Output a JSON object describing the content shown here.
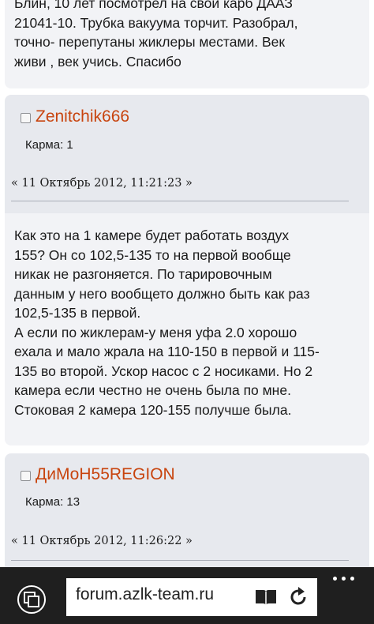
{
  "posts": [
    {
      "body_lines": [
        "Блин, 10 лет посмотрел на свой карб ДААЗ",
        "21041-10. Трубка вакуума торчит. Разобрал,",
        "точно- перепутаны жиклеры местами. Век",
        "живи , век учись. Спасибо"
      ]
    },
    {
      "author": "Zenitchik666",
      "karma": "Карма: 1",
      "date": "« 11 Октябрь 2012, 11:21:23 »",
      "body_lines": [
        "Как это на 1 камере будет работать воздух",
        "155? Он со 102,5-135 то на первой вообще",
        "никак не разгоняется. По тарировочным",
        "данным у него вообщето должно быть как раз",
        "102,5-135 в первой.",
        "А если по жиклерам-у меня уфа 2.0 хорошо",
        "ехала и мало жрала на 110-150 в первой и 115-",
        "135 во второй. Ускор насос с 2 носиками. Но 2",
        "камера если честно не очень была по мне.",
        "Стоковая 2 камера 120-155 получше была."
      ]
    },
    {
      "author": "ДиМоН55REGION",
      "karma": "Карма: 13",
      "date": "« 11 Октябрь 2012, 11:26:22 »"
    }
  ],
  "browser": {
    "address": "forum.azlk-team.ru",
    "icons": {
      "tabs": "tabs-icon",
      "reader": "reading-view-icon",
      "refresh": "refresh-icon",
      "more": "more-icon"
    }
  }
}
